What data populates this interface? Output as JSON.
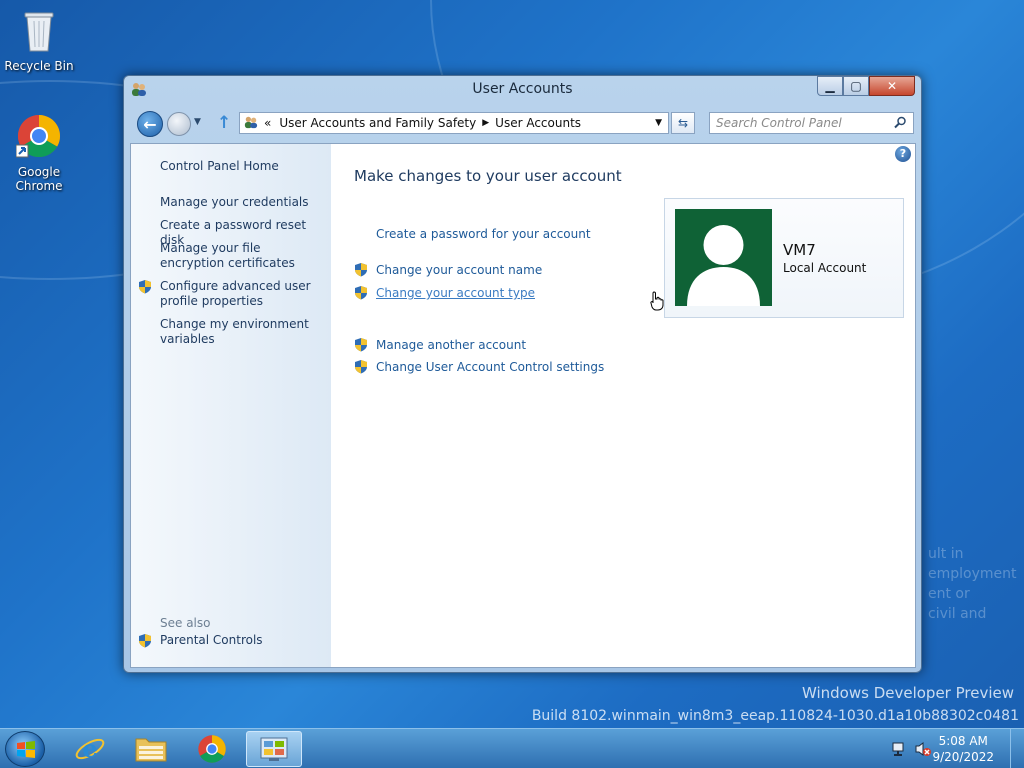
{
  "desktop": {
    "icons": [
      {
        "label": "Recycle Bin"
      },
      {
        "label": "Google\nChrome"
      }
    ],
    "watermark": {
      "line1": "Windows Developer Preview",
      "line2": "Build 8102.winmain_win8m3_eeap.110824-1030.d1a10b88302c0481",
      "ghost_lines": [
        "ult in",
        "employment",
        "ent or",
        "civil and"
      ]
    }
  },
  "window": {
    "title": "User Accounts",
    "address": {
      "prefix": "«",
      "crumb1": "User Accounts and Family Safety",
      "crumb2": "User Accounts"
    },
    "search_placeholder": "Search Control Panel",
    "left_pane": {
      "home": "Control Panel Home",
      "links": [
        "Manage your credentials",
        "Create a password reset disk",
        "Manage your file encryption certificates",
        "Configure advanced user profile properties",
        "Change my environment variables"
      ],
      "see_also": "See also",
      "parental": "Parental Controls"
    },
    "main": {
      "title": "Make changes to your user account",
      "tasks": [
        "Create a password for your account",
        "Change your account name",
        "Change your account type",
        "Manage another account",
        "Change User Account Control settings"
      ]
    },
    "account": {
      "name": "VM7",
      "type": "Local Account"
    }
  },
  "taskbar": {
    "time": "5:08 AM",
    "date": "9/20/2022"
  },
  "colors": {
    "link": "#1e5a99",
    "avatar_bg": "#0f6236",
    "uac_shield_blue": "#2f6db5",
    "uac_shield_yellow": "#f2c230"
  }
}
